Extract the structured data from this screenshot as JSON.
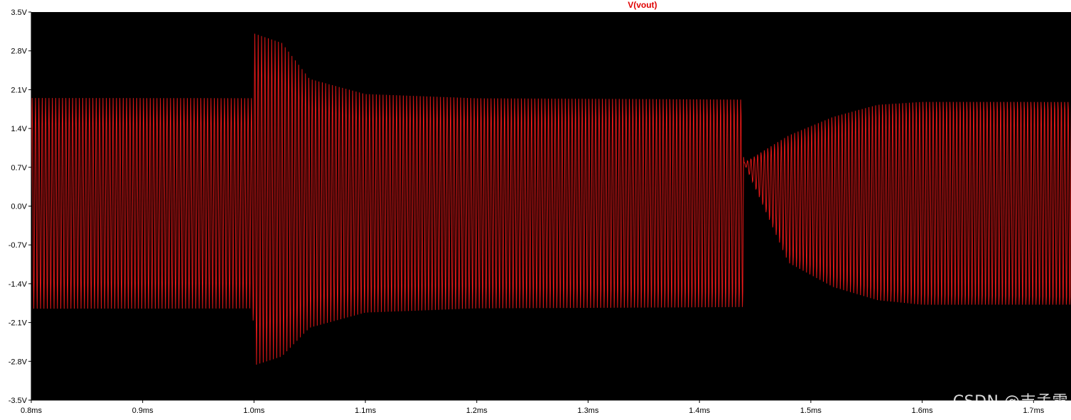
{
  "chart_data": {
    "type": "line",
    "title": "V(vout)",
    "xlabel": "",
    "ylabel": "",
    "x_ticks": [
      "0.8ms",
      "0.9ms",
      "1.0ms",
      "1.1ms",
      "1.2ms",
      "1.3ms",
      "1.4ms",
      "1.5ms",
      "1.6ms",
      "1.7ms"
    ],
    "x_tick_values": [
      0.8,
      0.9,
      1.0,
      1.1,
      1.2,
      1.3,
      1.4,
      1.5,
      1.6,
      1.7
    ],
    "y_ticks": [
      "3.5V",
      "2.8V",
      "2.1V",
      "1.4V",
      "0.7V",
      "0.0V",
      "-0.7V",
      "-1.4V",
      "-2.1V",
      "-2.8V",
      "-3.5V"
    ],
    "y_tick_values": [
      3.5,
      2.8,
      2.1,
      1.4,
      0.7,
      0.0,
      -0.7,
      -1.4,
      -2.1,
      -2.8,
      -3.5
    ],
    "xlim": [
      0.8,
      1.79
    ],
    "ylim": [
      -3.5,
      3.5
    ],
    "grid": false,
    "colors": {
      "background": "#000000",
      "trace": "#e01818",
      "title": "#e00000",
      "axis": "#000000"
    },
    "series": [
      {
        "name": "V(vout)",
        "kind": "sinusoid-envelope",
        "carrier_cycles_per_ms": 330,
        "envelope": [
          {
            "x": 0.8,
            "upper": 1.95,
            "lower": -1.85
          },
          {
            "x": 0.999,
            "upper": 1.95,
            "lower": -1.85
          },
          {
            "x": 1.0,
            "upper": 3.12,
            "lower": -2.88
          },
          {
            "x": 1.025,
            "upper": 2.95,
            "lower": -2.72
          },
          {
            "x": 1.05,
            "upper": 2.3,
            "lower": -2.2
          },
          {
            "x": 1.1,
            "upper": 2.03,
            "lower": -1.93
          },
          {
            "x": 1.2,
            "upper": 1.96,
            "lower": -1.86
          },
          {
            "x": 1.439,
            "upper": 1.96,
            "lower": -1.86
          },
          {
            "x": 1.44,
            "upper": 0.78,
            "lower": 0.78
          },
          {
            "x": 1.48,
            "upper": 1.3,
            "lower": -1.05
          },
          {
            "x": 1.52,
            "upper": 1.65,
            "lower": -1.5
          },
          {
            "x": 1.56,
            "upper": 1.88,
            "lower": -1.75
          },
          {
            "x": 1.6,
            "upper": 1.94,
            "lower": -1.84
          },
          {
            "x": 1.79,
            "upper": 1.97,
            "lower": -1.87
          }
        ]
      }
    ]
  },
  "watermark": "CSDN @吉孟雷"
}
